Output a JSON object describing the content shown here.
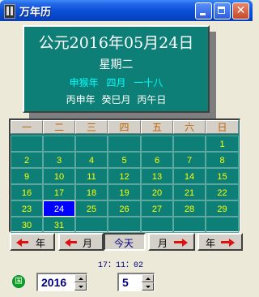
{
  "window": {
    "title": "万年历",
    "icons": {
      "app": "calendar-app-icon",
      "minimize": "minimize-icon",
      "maximize": "maximize-icon",
      "close": "close-icon"
    }
  },
  "header": {
    "date": "公元2016年05月24日",
    "weekday": "星期二",
    "lunar": {
      "year": "申猴年",
      "month": "四月",
      "day": "一十八"
    },
    "ganzhi": {
      "year": "丙申年",
      "month": "癸巳月",
      "day": "丙午日"
    }
  },
  "calendar": {
    "weekdays": [
      "一",
      "二",
      "三",
      "四",
      "五",
      "六",
      "日"
    ],
    "weeks": [
      [
        "",
        "",
        "",
        "",
        "",
        "",
        "1"
      ],
      [
        "2",
        "3",
        "4",
        "5",
        "6",
        "7",
        "8"
      ],
      [
        "9",
        "10",
        "11",
        "12",
        "13",
        "14",
        "15"
      ],
      [
        "16",
        "17",
        "18",
        "19",
        "20",
        "21",
        "22"
      ],
      [
        "23",
        "24",
        "25",
        "26",
        "27",
        "28",
        "29"
      ],
      [
        "30",
        "31",
        "",
        "",
        "",
        "",
        ""
      ]
    ],
    "selected_day": "24"
  },
  "nav": {
    "prev_year": "年",
    "prev_month": "月",
    "today": "今天",
    "next_month": "月",
    "next_year": "年"
  },
  "clock": "17：11：02",
  "controls": {
    "round_button": "国",
    "year_value": "2016",
    "month_value": "5"
  },
  "colors": {
    "panel_bg": "#0e7f76",
    "day_text": "#ffff00",
    "selected_bg": "#0000ff",
    "arrow": "#e01010"
  }
}
